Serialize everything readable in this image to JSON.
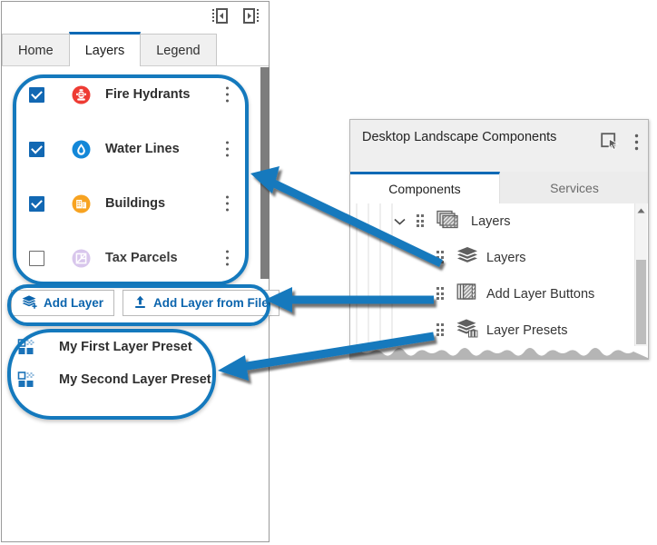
{
  "left_panel": {
    "dock_icons": [
      {
        "name": "dock-left-icon"
      },
      {
        "name": "dock-right-icon"
      }
    ],
    "tabs": [
      {
        "label": "Home",
        "active": false
      },
      {
        "label": "Layers",
        "active": true
      },
      {
        "label": "Legend",
        "active": false
      }
    ],
    "layers": [
      {
        "label": "Fire Hydrants",
        "checked": true,
        "icon": "fire-hydrant-icon",
        "color": "#ee3b33"
      },
      {
        "label": "Water Lines",
        "checked": true,
        "icon": "water-drop-icon",
        "color": "#1387d8"
      },
      {
        "label": "Buildings",
        "checked": true,
        "icon": "building-icon",
        "color": "#f7a321"
      },
      {
        "label": "Tax Parcels",
        "checked": false,
        "icon": "tax-parcel-icon",
        "color": "#cdb7e5"
      }
    ],
    "buttons": [
      {
        "label": "Add Layer",
        "icon": "add-layer-icon"
      },
      {
        "label": "Add Layer from File",
        "icon": "upload-icon"
      }
    ],
    "presets": [
      {
        "label": "My First Layer Preset",
        "icon": "layer-preset-icon"
      },
      {
        "label": "My Second Layer Preset",
        "icon": "layer-preset-icon"
      }
    ]
  },
  "right_panel": {
    "title": "Desktop Landscape Components",
    "header_icons": [
      {
        "name": "select-pointer-icon"
      },
      {
        "name": "more-options-icon"
      }
    ],
    "tabs": [
      {
        "label": "Components",
        "active": true
      },
      {
        "label": "Services",
        "active": false
      }
    ],
    "tree": [
      {
        "label": "Layers",
        "icon": "layers-group-icon",
        "level": 0,
        "expanded": true
      },
      {
        "label": "Layers",
        "icon": "layers-stack-icon",
        "level": 1
      },
      {
        "label": "Add Layer Buttons",
        "icon": "add-layer-buttons-icon",
        "level": 1
      },
      {
        "label": "Layer Presets",
        "icon": "layer-presets-icon",
        "level": 1
      }
    ]
  },
  "annotations": {
    "highlight_color": "#1479bd",
    "callouts": [
      {
        "from": "Layers (tree item)",
        "to": "layer-list"
      },
      {
        "from": "Add Layer Buttons (tree item)",
        "to": "add-layer-buttons"
      },
      {
        "from": "Layer Presets (tree item)",
        "to": "layer-presets"
      }
    ]
  }
}
